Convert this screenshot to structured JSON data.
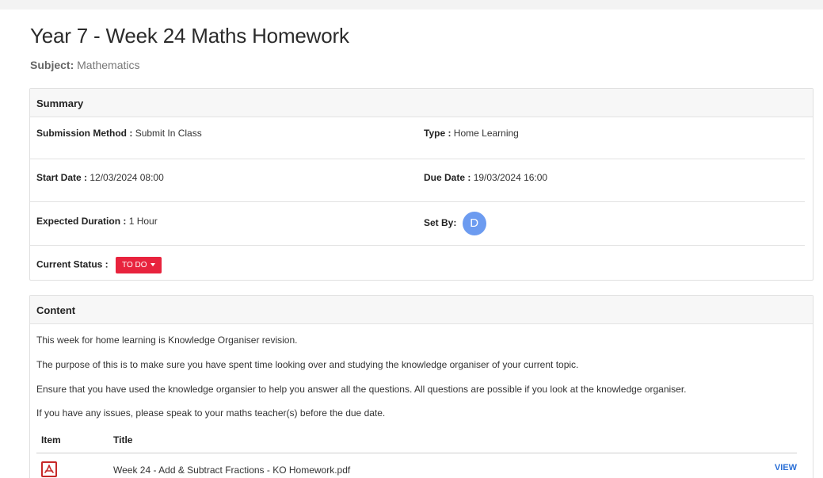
{
  "page": {
    "title": "Year 7 - Week 24 Maths Homework",
    "subject_label": "Subject:",
    "subject_value": "Mathematics"
  },
  "summary": {
    "heading": "Summary",
    "submission_method_label": "Submission Method :",
    "submission_method_value": "Submit In Class",
    "type_label": "Type :",
    "type_value": "Home Learning",
    "start_date_label": "Start Date :",
    "start_date_value": "12/03/2024 08:00",
    "due_date_label": "Due Date :",
    "due_date_value": "19/03/2024 16:00",
    "expected_duration_label": "Expected Duration :",
    "expected_duration_value": "1 Hour",
    "set_by_label": "Set By:",
    "set_by_initial": "D",
    "current_status_label": "Current Status :",
    "current_status_value": "TO DO"
  },
  "content": {
    "heading": "Content",
    "paragraphs": [
      "This week for home learning is Knowledge Organiser revision.",
      "The purpose of this is to make sure you have spent time looking over and studying the knowledge organiser of your current topic.",
      "Ensure that you have used the knowledge organsier to help you answer all the questions. All questions are possible if you look at the knowledge organiser.",
      "If you have any issues, please speak to your maths teacher(s) before the due date."
    ],
    "table": {
      "headers": [
        "Item",
        "Title"
      ],
      "rows": [
        {
          "icon": "pdf-icon",
          "title": "Week 24 - Add & Subtract Fractions - KO Homework.pdf",
          "action": "VIEW"
        }
      ]
    }
  },
  "colors": {
    "status_red": "#e8233d",
    "avatar_blue": "#6c9bf0",
    "link_blue": "#2a6fd6",
    "pdf_red": "#c62828"
  }
}
